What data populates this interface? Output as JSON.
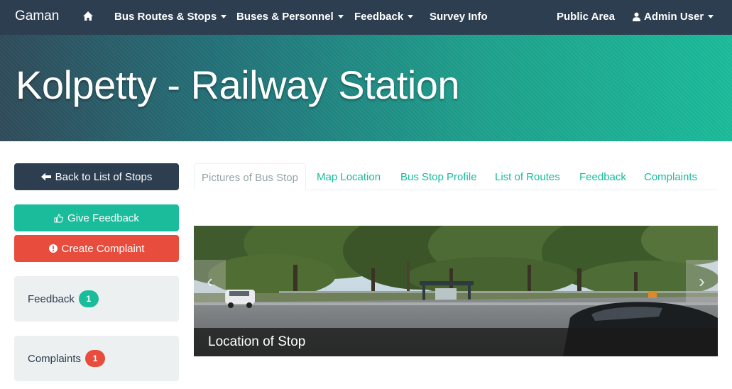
{
  "nav": {
    "brand": "Gaman",
    "items": [
      {
        "label": "Bus Routes & Stops"
      },
      {
        "label": "Buses & Personnel"
      },
      {
        "label": "Feedback"
      },
      {
        "label": "Survey Info"
      }
    ],
    "public_area": "Public Area",
    "user": "Admin User"
  },
  "page": {
    "title": "Kolpetty - Railway Station"
  },
  "sidebar": {
    "back_button": "Back to List of Stops",
    "feedback_button": "Give Feedback",
    "complaint_button": "Create Complaint",
    "feedback_label": "Feedback",
    "feedback_count": "1",
    "complaints_label": "Complaints",
    "complaints_count": "1"
  },
  "tabs": [
    {
      "label": "Pictures of Bus Stop",
      "active": true
    },
    {
      "label": "Map Location"
    },
    {
      "label": "Bus Stop Profile"
    },
    {
      "label": "List of Routes"
    },
    {
      "label": "Feedback"
    },
    {
      "label": "Complaints"
    }
  ],
  "carousel": {
    "caption": "Location of Stop",
    "prev": "‹",
    "next": "›"
  },
  "colors": {
    "navbar": "#2c3e50",
    "accent": "#1abc9c",
    "danger": "#e74c3c",
    "well": "#ecf0f1"
  }
}
